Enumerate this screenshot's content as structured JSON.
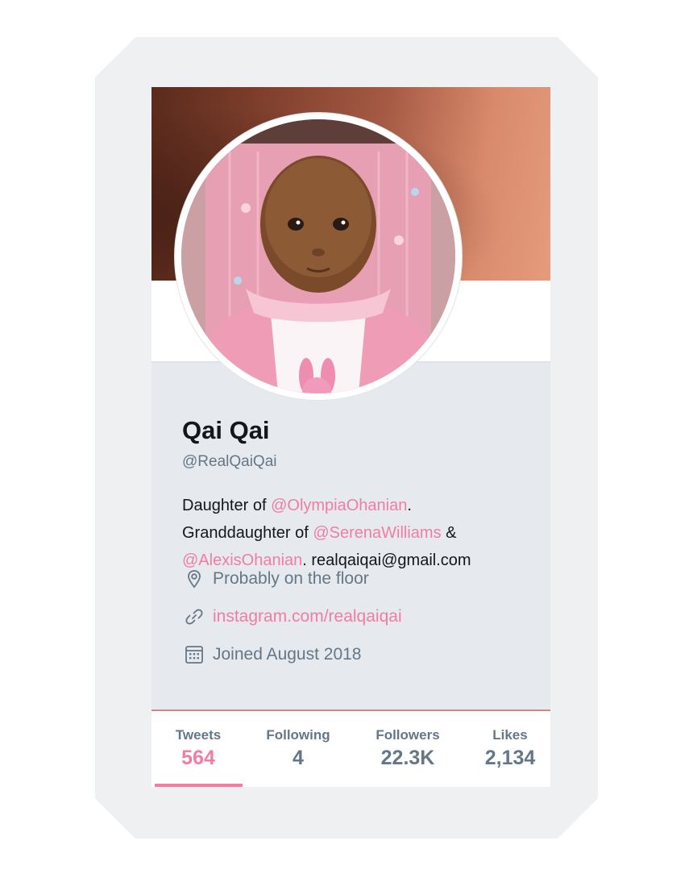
{
  "profile": {
    "name": "Qai Qai",
    "handle": "@RealQaiQai",
    "bio": {
      "line1_prefix": "Daughter of ",
      "mention1": "@OlympiaOhanian",
      "line1_suffix": ".",
      "line2_prefix": "Granddaughter of ",
      "mention2": "@SerenaWilliams",
      "line2_suffix": " &",
      "mention3": "@AlexisOhanian",
      "line3_suffix": ". realqaiqai@gmail.com"
    },
    "location": "Probably on the floor",
    "website": "instagram.com/realqaiqai",
    "joined": "Joined August 2018"
  },
  "stats": [
    {
      "label": "Tweets",
      "value": "564",
      "active": true
    },
    {
      "label": "Following",
      "value": "4",
      "active": false
    },
    {
      "label": "Followers",
      "value": "22.3K",
      "active": false
    },
    {
      "label": "Likes",
      "value": "2,134",
      "active": false
    }
  ],
  "icons": {
    "location": "location-pin-icon",
    "website": "link-icon",
    "joined": "calendar-icon"
  },
  "colors": {
    "accent": "#f07ea0",
    "secondary_text": "#657786",
    "primary_text": "#14171a",
    "info_background": "#e6e9ee"
  }
}
